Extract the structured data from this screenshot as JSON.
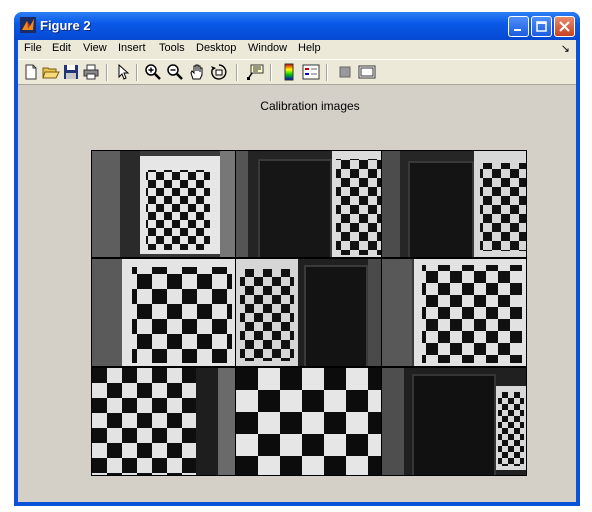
{
  "window": {
    "title": "Figure 2",
    "title_bar_color": "#0a5ae8"
  },
  "menubar": {
    "items": [
      "File",
      "Edit",
      "View",
      "Insert",
      "Tools",
      "Desktop",
      "Window",
      "Help"
    ],
    "overflow_arrow": "↘"
  },
  "toolbar": {
    "icons": [
      "new-figure-icon",
      "open-file-icon",
      "save-icon",
      "print-icon",
      "pointer-icon",
      "zoom-in-icon",
      "zoom-out-icon",
      "pan-hand-icon",
      "rotate-3d-icon",
      "data-cursor-icon",
      "colorbar-icon",
      "legend-icon",
      "hide-plot-tools-icon",
      "show-plot-tools-icon"
    ]
  },
  "figure": {
    "title": "Calibration images",
    "image_grid": {
      "rows": 3,
      "cols": 3,
      "count": 9
    }
  }
}
